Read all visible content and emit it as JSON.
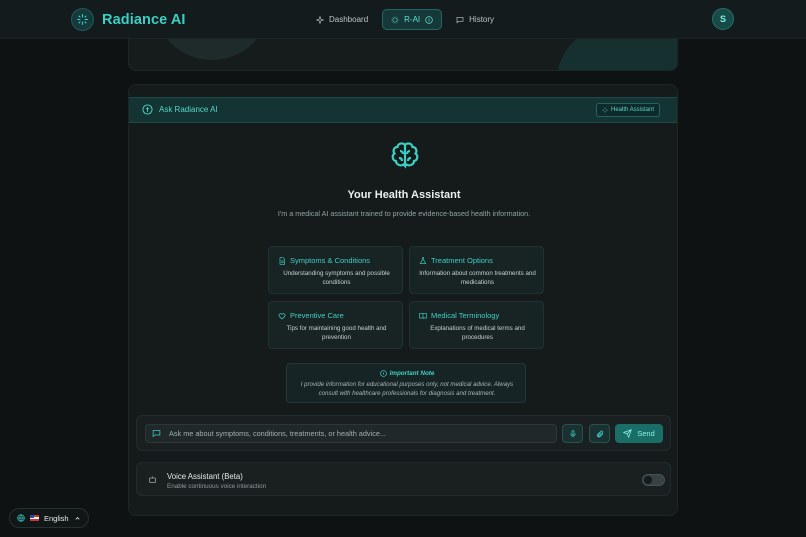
{
  "app": {
    "name": "Radiance AI"
  },
  "nav": {
    "items": [
      {
        "label": "Dashboard",
        "icon": "sparkle-icon",
        "active": false
      },
      {
        "label": "R-AI",
        "icon": "sparkle-icon",
        "active": true
      },
      {
        "label": "History",
        "icon": "chat-bubble-icon",
        "active": false
      }
    ]
  },
  "user": {
    "initial": "S"
  },
  "chat": {
    "header_title": "Ask Radiance AI",
    "badge": "Health Assistant",
    "hero_title": "Your Health Assistant",
    "hero_subtitle": "I'm a medical AI assistant trained to provide evidence-based health information.",
    "tiles": [
      {
        "title": "Symptoms & Conditions",
        "desc": "Understanding symptoms and possible conditions",
        "icon": "document-icon"
      },
      {
        "title": "Treatment Options",
        "desc": "Information about common treatments and medications",
        "icon": "flask-icon"
      },
      {
        "title": "Preventive Care",
        "desc": "Tips for maintaining good health and prevention",
        "icon": "heart-icon"
      },
      {
        "title": "Medical Terminology",
        "desc": "Explanations of medical terms and procedures",
        "icon": "book-icon"
      }
    ],
    "note": {
      "title": "Important Note",
      "text": "I provide information for educational purposes only, not medical advice. Always consult with healthcare professionals for diagnosis and treatment."
    },
    "input": {
      "placeholder": "Ask me about symptoms, conditions, treatments, or health advice...",
      "value": ""
    },
    "send_label": "Send",
    "voice": {
      "title": "Voice Assistant (Beta)",
      "subtitle": "Enable continuous voice interaction",
      "enabled": false
    }
  },
  "language": {
    "label": "English"
  },
  "colors": {
    "accent": "#3ad0c4",
    "background": "#0e1213",
    "card": "#151a1b"
  }
}
